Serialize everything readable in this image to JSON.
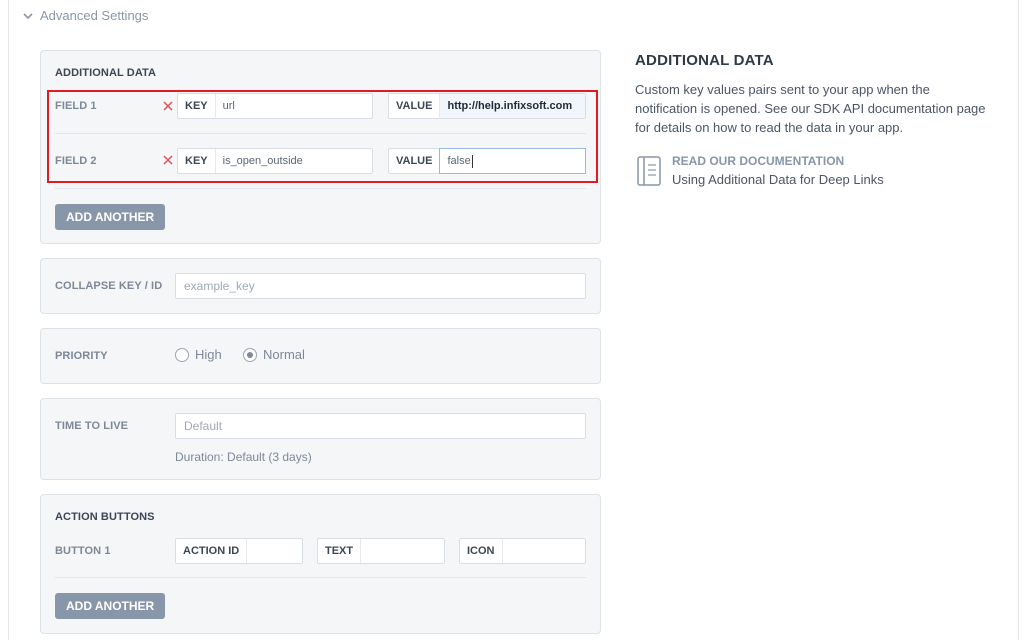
{
  "header": {
    "toggle_label": "Advanced Settings"
  },
  "additional_data": {
    "section_label": "ADDITIONAL DATA",
    "fields": [
      {
        "label": "FIELD 1",
        "key_tag": "KEY",
        "key": "url",
        "value_tag": "VALUE",
        "value": "http://help.infixsoft.com"
      },
      {
        "label": "FIELD 2",
        "key_tag": "KEY",
        "key": "is_open_outside",
        "value_tag": "VALUE",
        "value": "false"
      }
    ],
    "add_button": "ADD ANOTHER"
  },
  "collapse_key": {
    "label": "COLLAPSE KEY / ID",
    "placeholder": "example_key"
  },
  "priority": {
    "label": "PRIORITY",
    "options": [
      "High",
      "Normal"
    ],
    "selected": "Normal"
  },
  "ttl": {
    "label": "TIME TO LIVE",
    "placeholder": "Default",
    "hint": "Duration: Default (3 days)"
  },
  "action_buttons": {
    "section_label": "ACTION BUTTONS",
    "button_label": "BUTTON 1",
    "action_id_tag": "ACTION ID",
    "text_tag": "TEXT",
    "icon_tag": "ICON",
    "add_button": "ADD ANOTHER"
  },
  "sidebar": {
    "title": "ADDITIONAL DATA",
    "description": "Custom key values pairs sent to your app when the notification is opened. See our SDK API documentation page for details on how to read the data in your app.",
    "doc_link": "READ OUR DOCUMENTATION",
    "doc_sub": "Using Additional Data for Deep Links"
  },
  "colors": {
    "highlight": "#e01b24",
    "button": "#8796a8",
    "remove_icon": "#e05050"
  }
}
